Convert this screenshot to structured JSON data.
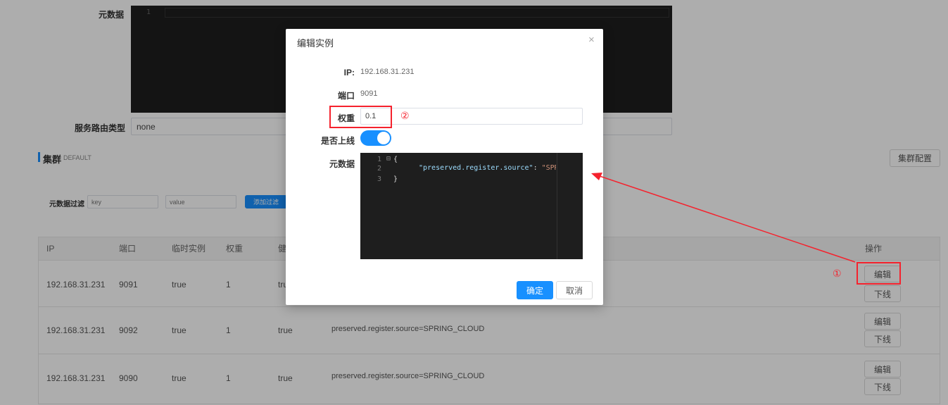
{
  "background": {
    "metadata_label": "元数据",
    "editor_line_number": "1",
    "route_type_label": "服务路由类型",
    "route_type_value": "none",
    "cluster_title": "集群",
    "cluster_name": "DEFAULT",
    "cluster_config_button": "集群配置",
    "filter_label": "元数据过滤",
    "filter_key_placeholder": "key",
    "filter_value_placeholder": "value",
    "add_filter_button": "添加过滤"
  },
  "table": {
    "headers": {
      "ip": "IP",
      "port": "端口",
      "ephemeral": "临时实例",
      "weight": "权重",
      "healthy": "健",
      "actions": "操作"
    },
    "rows": [
      {
        "ip": "192.168.31.231",
        "port": "9091",
        "ephemeral": "true",
        "weight": "1",
        "healthy": "tru",
        "metadata": ""
      },
      {
        "ip": "192.168.31.231",
        "port": "9092",
        "ephemeral": "true",
        "weight": "1",
        "healthy": "true",
        "metadata": "preserved.register.source=SPRING_CLOUD"
      },
      {
        "ip": "192.168.31.231",
        "port": "9090",
        "ephemeral": "true",
        "weight": "1",
        "healthy": "true",
        "metadata": "preserved.register.source=SPRING_CLOUD"
      }
    ],
    "edit_button": "编辑",
    "offline_button": "下线"
  },
  "modal": {
    "title": "编辑实例",
    "close_glyph": "×",
    "ip_label": "IP:",
    "ip_value": "192.168.31.231",
    "port_label": "端口",
    "port_value": "9091",
    "weight_label": "权重",
    "weight_value": "0.1",
    "online_label": "是否上线",
    "online_enabled": true,
    "metadata_label": "元数据",
    "code_lines": [
      {
        "num": "1",
        "fold": "⊟",
        "text": "{"
      },
      {
        "num": "2",
        "fold": "",
        "key": "\"preserved.register.source\"",
        "colon": ": ",
        "value": "\"SPRING"
      },
      {
        "num": "3",
        "fold": "",
        "text": "}"
      }
    ],
    "ok_button": "确定",
    "cancel_button": "取消"
  },
  "annotations": {
    "marker_1": "①",
    "marker_2": "②"
  },
  "colors": {
    "primary": "#1890ff",
    "annotation_red": "#f5222d",
    "editor_bg": "#1e1e1e",
    "json_key": "#9cdcfe",
    "json_value": "#ce9178"
  }
}
